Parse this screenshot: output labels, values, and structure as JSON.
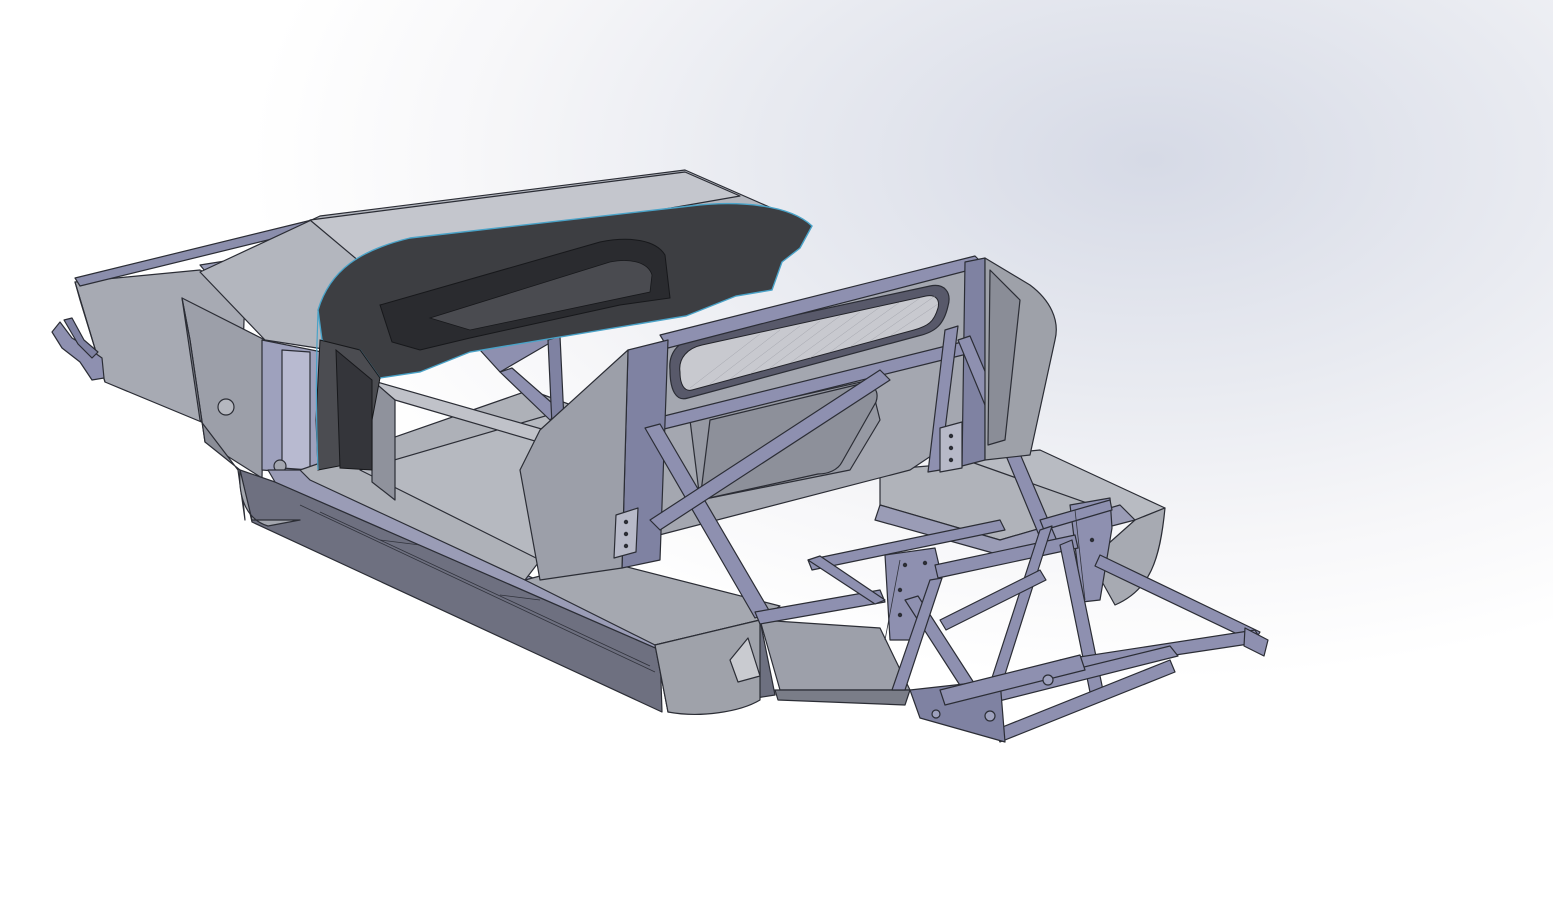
{
  "viewport": {
    "background_top": "#d6dae6",
    "background_bottom": "#ffffff",
    "model_colors": {
      "panel_light": "#b9bcc4",
      "panel_mid": "#9da0aa",
      "panel_dark": "#7d808b",
      "tube": "#8e90b0",
      "tube_dark": "#6f7292",
      "dash": "#3d3e42",
      "dash_edge": "#4aa3c8",
      "edge": "#2b2d35"
    }
  }
}
